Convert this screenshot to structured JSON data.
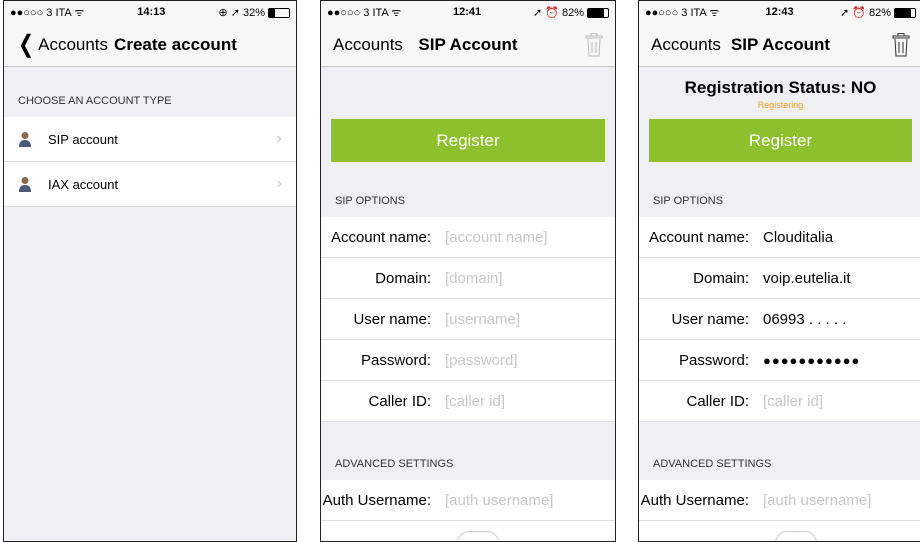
{
  "screen1": {
    "status": {
      "left": "●●○○○ 3 ITA ᯤ",
      "time": "14:13",
      "right": "⊕ ➚ 32%"
    },
    "nav": {
      "back_label": "Accounts",
      "title": "Create account"
    },
    "section_header": "CHOOSE AN ACCOUNT TYPE",
    "items": [
      {
        "label": "SIP account",
        "icon": "person-icon"
      },
      {
        "label": "IAX account",
        "icon": "person-icon"
      }
    ]
  },
  "screen2": {
    "status": {
      "left": "●●○○○ 3 ITA ᯤ",
      "time": "12:41",
      "right": "➚ ⏰ 82%"
    },
    "nav": {
      "back_label": "Accounts",
      "title": "SIP Account"
    },
    "register_label": "Register",
    "sip_options_header": "SIP OPTIONS",
    "fields": [
      {
        "label": "Account name:",
        "placeholder": "[account name]"
      },
      {
        "label": "Domain:",
        "placeholder": "[domain]"
      },
      {
        "label": "User name:",
        "placeholder": "[username]"
      },
      {
        "label": "Password:",
        "placeholder": "[password]"
      },
      {
        "label": "Caller ID:",
        "placeholder": "[caller id]"
      }
    ],
    "advanced_header": "ADVANCED SETTINGS",
    "auth": {
      "label": "Auth Username:",
      "placeholder": "[auth username]"
    }
  },
  "screen3": {
    "status": {
      "left": "●●○○○ 3 ITA ᯤ",
      "time": "12:43",
      "right": "➚ ⏰ 82%"
    },
    "nav": {
      "back_label": "Accounts",
      "title": "SIP Account"
    },
    "registration_status": "Registration Status: NO",
    "registration_sub": "Registering",
    "register_label": "Register",
    "sip_options_header": "SIP OPTIONS",
    "fields": [
      {
        "label": "Account name:",
        "value": "Clouditalia"
      },
      {
        "label": "Domain:",
        "value": "voip.eutelia.it"
      },
      {
        "label": "User name:",
        "value": "06993 . . . . ."
      },
      {
        "label": "Password:",
        "value": "●●●●●●●●●●●"
      },
      {
        "label": "Caller ID:",
        "placeholder": "[caller id]"
      }
    ],
    "advanced_header": "ADVANCED SETTINGS",
    "auth": {
      "label": "Auth Username:",
      "placeholder": "[auth username]"
    }
  },
  "colors": {
    "register_green": "#8dc02d",
    "registering_orange": "#f4a21a",
    "placeholder_gray": "#c7c7cc"
  }
}
